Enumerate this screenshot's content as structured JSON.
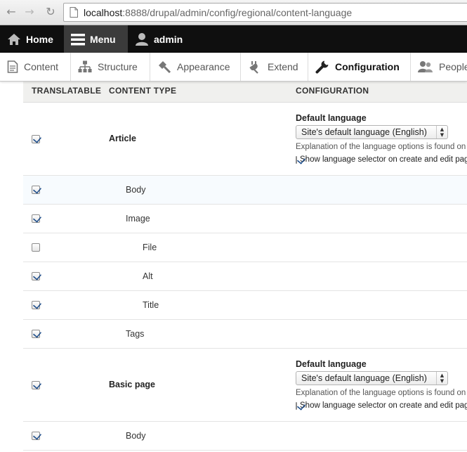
{
  "browser": {
    "url_host": "localhost",
    "url_rest": ":8888/drupal/admin/config/regional/content-language"
  },
  "toolbar": {
    "home": "Home",
    "menu": "Menu",
    "user": "admin"
  },
  "tray": {
    "items": [
      {
        "label": "Content",
        "icon": "content-icon"
      },
      {
        "label": "Structure",
        "icon": "structure-icon"
      },
      {
        "label": "Appearance",
        "icon": "appearance-icon"
      },
      {
        "label": "Extend",
        "icon": "extend-icon"
      },
      {
        "label": "Configuration",
        "icon": "configuration-icon",
        "active": true
      },
      {
        "label": "People",
        "icon": "people-icon"
      }
    ]
  },
  "table": {
    "headers": [
      "TRANSLATABLE",
      "CONTENT TYPE",
      "CONFIGURATION"
    ],
    "config_title": "Default language",
    "config_select": "Site's default language (English)",
    "config_desc": "Explanation of the language options is found on the",
    "config_show": "Show language selector on create and edit pages",
    "rows": [
      {
        "label": "Article",
        "checked": true
      },
      {
        "label": "Body",
        "checked": true
      },
      {
        "label": "Image",
        "checked": true
      },
      {
        "label": "File",
        "checked": false
      },
      {
        "label": "Alt",
        "checked": true
      },
      {
        "label": "Title",
        "checked": true
      },
      {
        "label": "Tags",
        "checked": true
      },
      {
        "label": "Basic page",
        "checked": true
      },
      {
        "label": "Body",
        "checked": true
      }
    ]
  }
}
